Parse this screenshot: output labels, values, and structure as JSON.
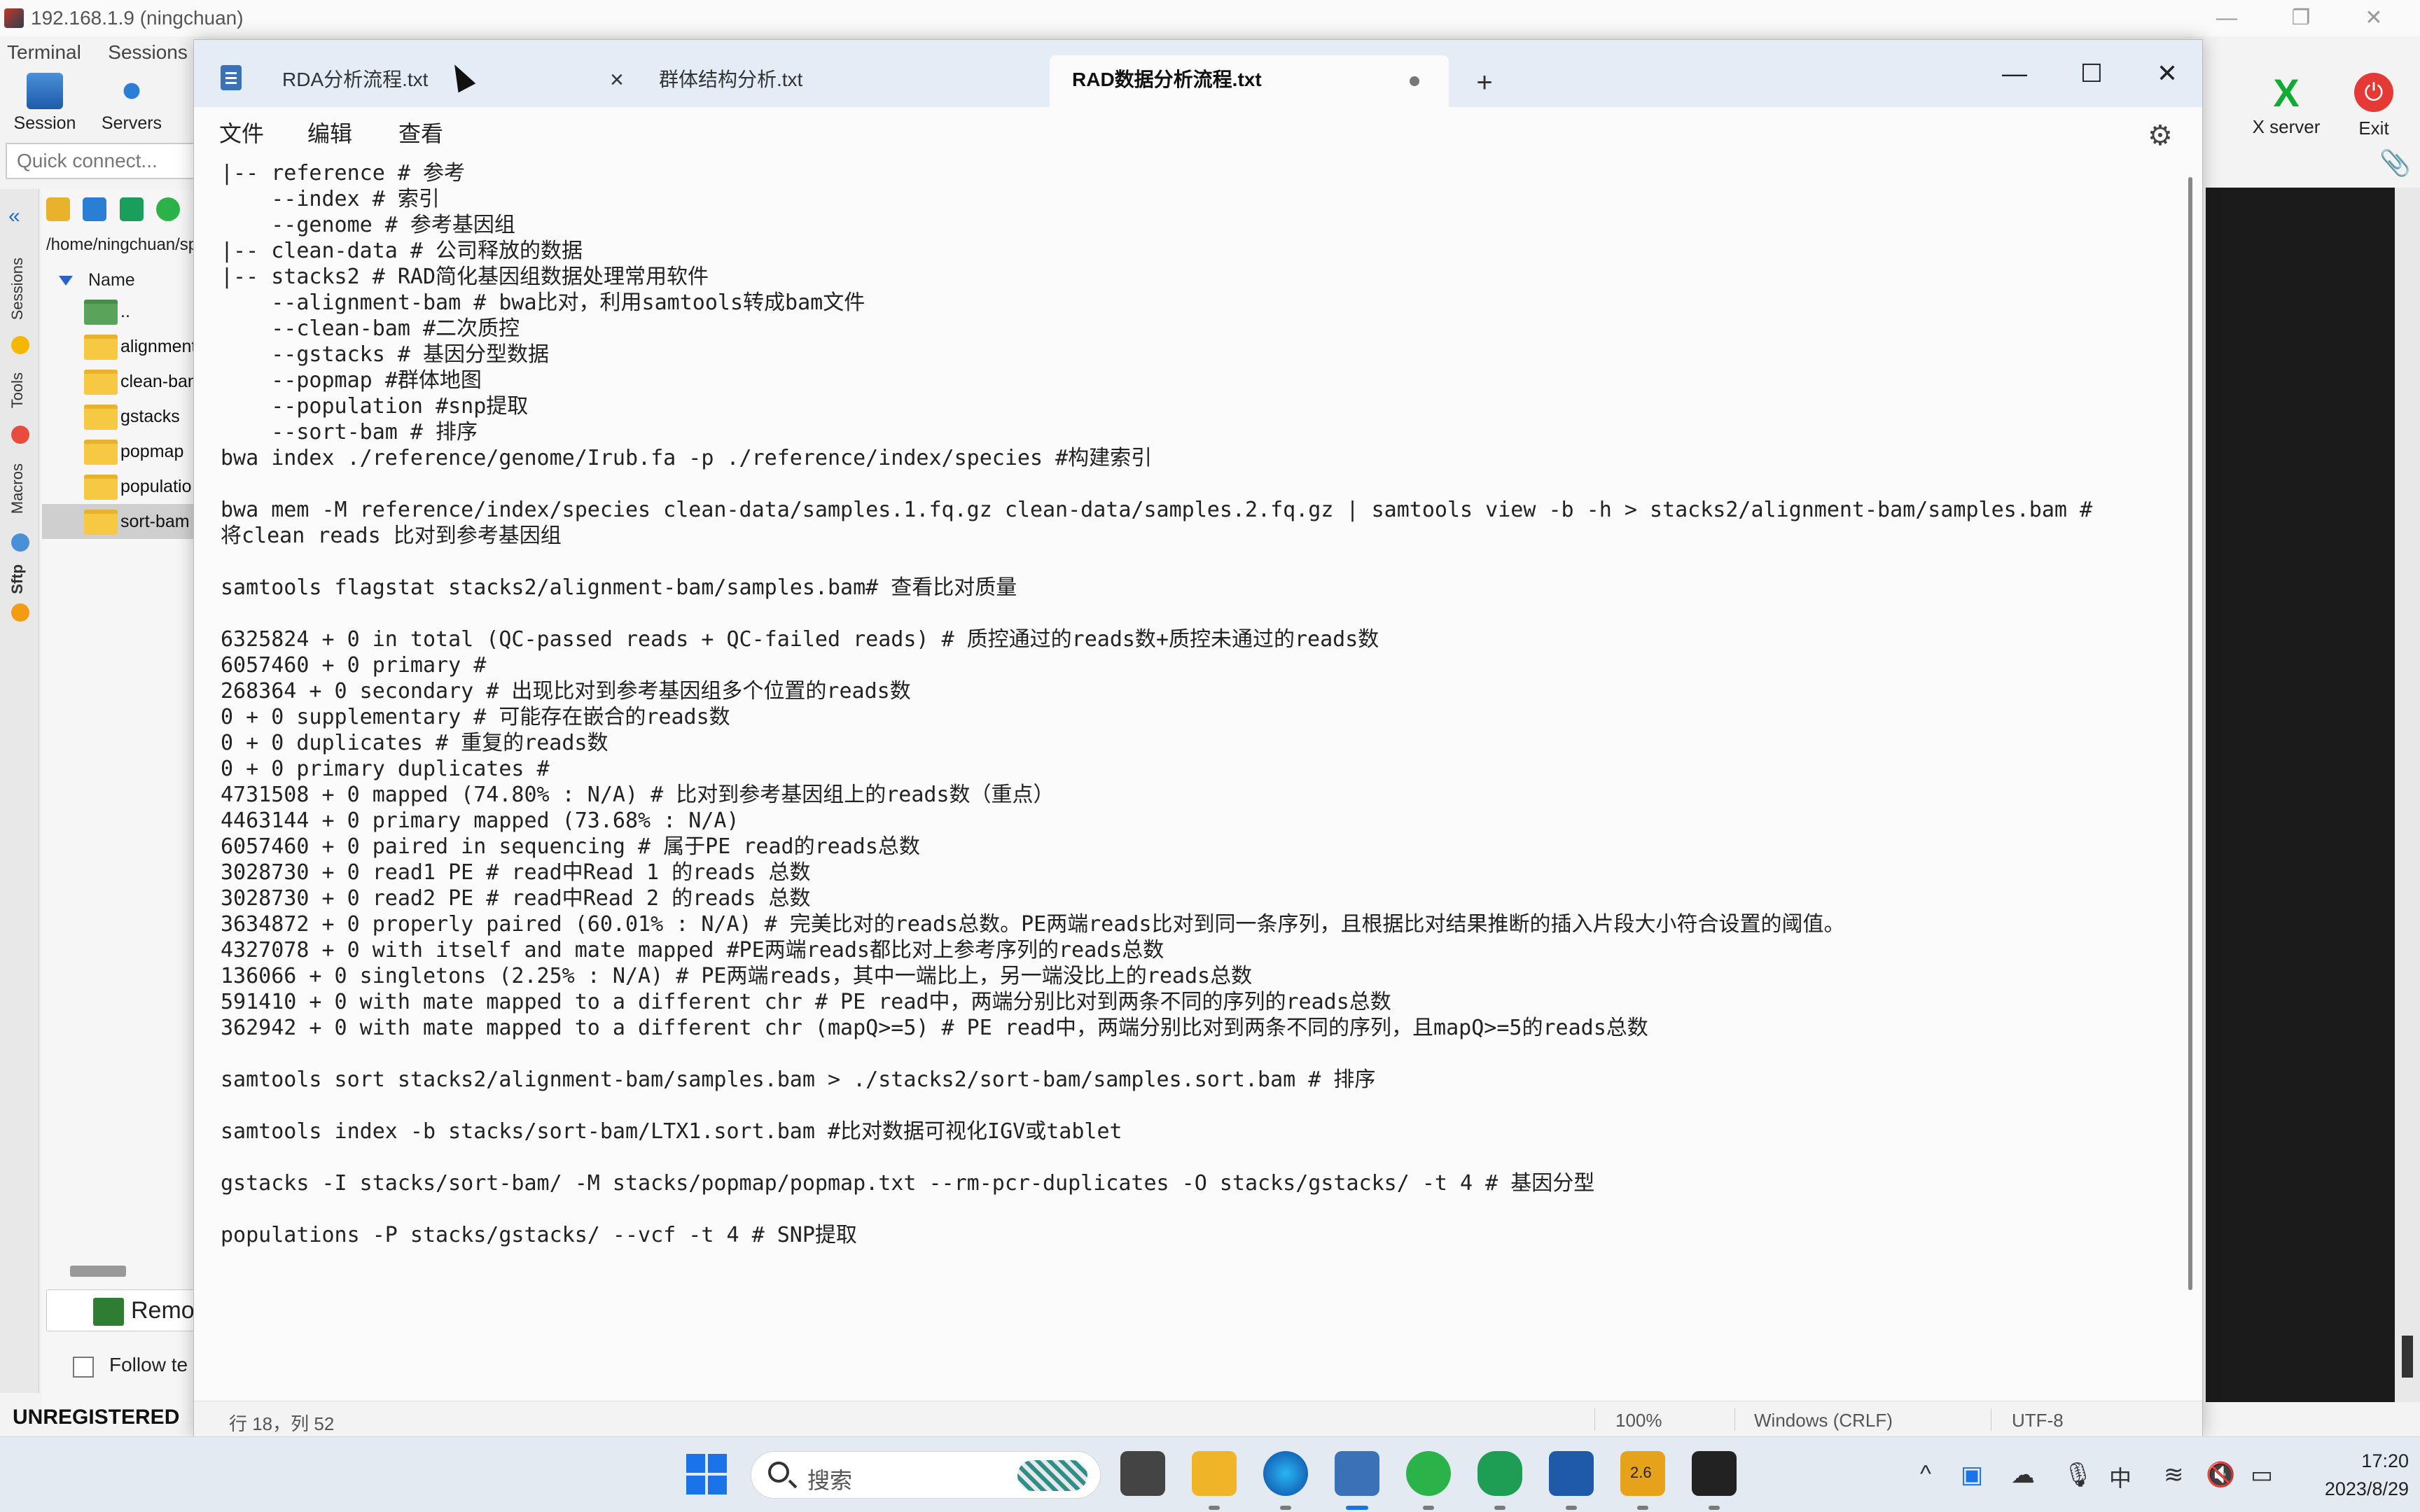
{
  "moba": {
    "title": "192.168.1.9 (ningchuan)",
    "menu": [
      "Terminal",
      "Sessions"
    ],
    "toolbar": [
      {
        "label": "Session",
        "icon": "monitor-icon"
      },
      {
        "label": "Servers",
        "icon": "servers-icon"
      }
    ],
    "quick_connect_placeholder": "Quick connect...",
    "side_tabs": [
      "Sessions",
      "Tools",
      "Macros",
      "Sftp"
    ],
    "sftp": {
      "path": "/home/ningchuan/sp",
      "column_name": "Name",
      "files": [
        {
          "name": "..",
          "kind": "parent"
        },
        {
          "name": "alignment",
          "kind": "folder"
        },
        {
          "name": "clean-ban",
          "kind": "folder"
        },
        {
          "name": "gstacks",
          "kind": "folder"
        },
        {
          "name": "popmap",
          "kind": "folder"
        },
        {
          "name": "populatio",
          "kind": "folder"
        },
        {
          "name": "sort-bam",
          "kind": "folder",
          "selected": true
        }
      ],
      "remote_label": "Remo",
      "follow_label": "Follow te"
    },
    "xserver_label": "X server",
    "exit_label": "Exit",
    "unregistered": "UNREGISTERED"
  },
  "notepad": {
    "tabs": [
      {
        "label": "RDA分析流程.txt",
        "state": "close"
      },
      {
        "label": "群体结构分析.txt",
        "state": "none"
      },
      {
        "label": "RAD数据分析流程.txt",
        "state": "modified",
        "active": true
      }
    ],
    "menu": [
      "文件",
      "编辑",
      "查看"
    ],
    "lines": [
      "|-- reference # 参考",
      "    --index # 索引",
      "    --genome # 参考基因组",
      "|-- clean-data # 公司释放的数据",
      "|-- stacks2 # RAD简化基因组数据处理常用软件",
      "    --alignment-bam # bwa比对，利用samtools转成bam文件",
      "    --clean-bam #二次质控",
      "    --gstacks # 基因分型数据",
      "    --popmap #群体地图",
      "    --population #snp提取",
      "    --sort-bam # 排序",
      "bwa index ./reference/genome/Irub.fa -p ./reference/index/species #构建索引",
      "",
      "bwa mem -M reference/index/species clean-data/samples.1.fq.gz clean-data/samples.2.fq.gz | samtools view -b -h > stacks2/alignment-bam/samples.bam #",
      "将clean reads 比对到参考基因组",
      "",
      "samtools flagstat stacks2/alignment-bam/samples.bam# 查看比对质量",
      "",
      "6325824 + 0 in total (QC-passed reads + QC-failed reads) # 质控通过的reads数+质控未通过的reads数",
      "6057460 + 0 primary #",
      "268364 + 0 secondary # 出现比对到参考基因组多个位置的reads数",
      "0 + 0 supplementary # 可能存在嵌合的reads数",
      "0 + 0 duplicates # 重复的reads数",
      "0 + 0 primary duplicates #",
      "4731508 + 0 mapped (74.80% : N/A) # 比对到参考基因组上的reads数（重点）",
      "4463144 + 0 primary mapped (73.68% : N/A)",
      "6057460 + 0 paired in sequencing # 属于PE read的reads总数",
      "3028730 + 0 read1 PE # read中Read 1 的reads 总数",
      "3028730 + 0 read2 PE # read中Read 2 的reads 总数",
      "3634872 + 0 properly paired (60.01% : N/A) # 完美比对的reads总数。PE两端reads比对到同一条序列，且根据比对结果推断的插入片段大小符合设置的阈值。",
      "4327078 + 0 with itself and mate mapped #PE两端reads都比对上参考序列的reads总数",
      "136066 + 0 singletons (2.25% : N/A) # PE两端reads，其中一端比上，另一端没比上的reads总数",
      "591410 + 0 with mate mapped to a different chr # PE read中，两端分别比对到两条不同的序列的reads总数",
      "362942 + 0 with mate mapped to a different chr (mapQ>=5) # PE read中，两端分别比对到两条不同的序列，且mapQ>=5的reads总数",
      "",
      "samtools sort stacks2/alignment-bam/samples.bam > ./stacks2/sort-bam/samples.sort.bam # 排序",
      "",
      "samtools index -b stacks/sort-bam/LTX1.sort.bam #比对数据可视化IGV或tablet",
      "",
      "gstacks -I stacks/sort-bam/ -M stacks/popmap/popmap.txt --rm-pcr-duplicates -O stacks/gstacks/ -t 4 # 基因分型",
      "",
      "populations -P stacks/gstacks/ --vcf -t 4 # SNP提取"
    ],
    "status": {
      "position": "行 18，列 52",
      "zoom": "100%",
      "line_ending": "Windows (CRLF)",
      "encoding": "UTF-8"
    }
  },
  "taskbar": {
    "search_label": "搜索",
    "ime": "中",
    "badge": "2.6",
    "time": "17:20",
    "date": "2023/8/29"
  }
}
